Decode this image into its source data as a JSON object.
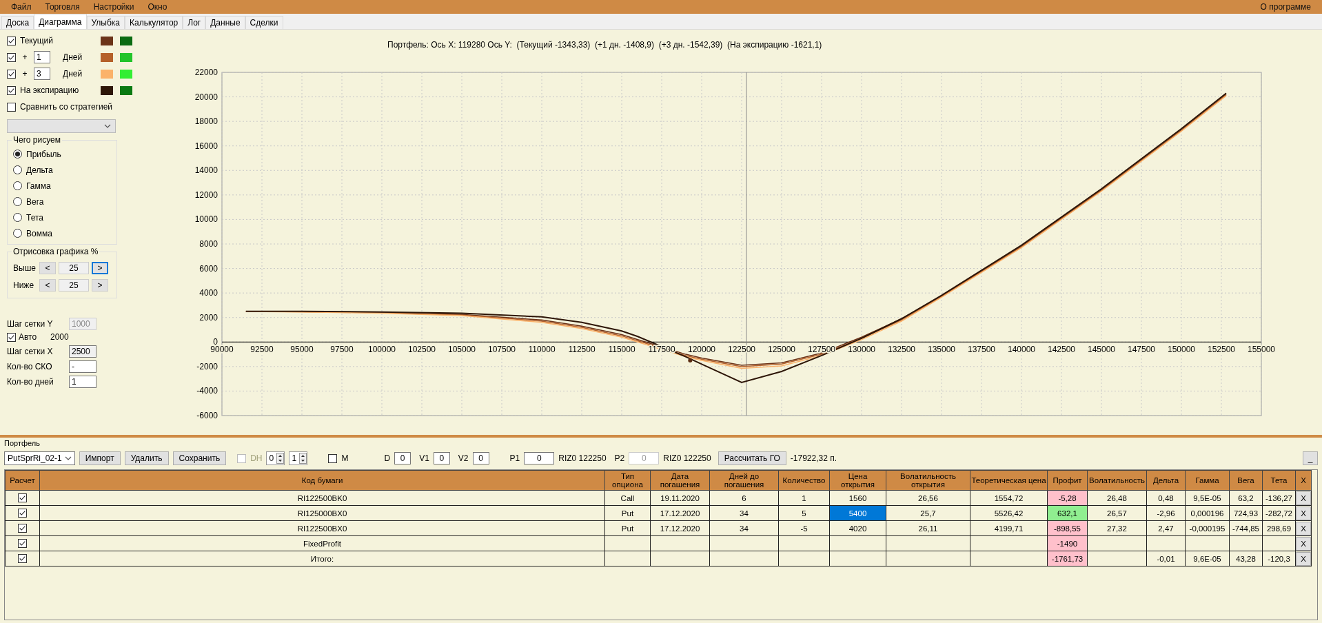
{
  "menu": {
    "items": [
      "Файл",
      "Торговля",
      "Настройки",
      "Окно"
    ],
    "about": "О программе"
  },
  "tabs": [
    {
      "label": "Доска",
      "selected": false
    },
    {
      "label": "Диаграмма",
      "selected": true
    },
    {
      "label": "Улыбка",
      "selected": false
    },
    {
      "label": "Калькулятор",
      "selected": false
    },
    {
      "label": "Лог",
      "selected": false
    },
    {
      "label": "Данные",
      "selected": false
    },
    {
      "label": "Сделки",
      "selected": false
    }
  ],
  "diagram": {
    "series_toggles": [
      {
        "kind": "label",
        "checked": true,
        "label": "Текущий",
        "swatches": [
          {
            "color": "#6b3318"
          },
          {
            "color": "#0b6b12"
          }
        ]
      },
      {
        "kind": "days",
        "checked": true,
        "sign": "+",
        "days": "1",
        "unit": "Дней",
        "swatches": [
          {
            "color": "#b5602a"
          },
          {
            "color": "#22c42a"
          }
        ]
      },
      {
        "kind": "days",
        "checked": true,
        "sign": "+",
        "days": "3",
        "unit": "Дней",
        "swatches": [
          {
            "color": "#fbb26a"
          },
          {
            "color": "#33ee33"
          }
        ]
      },
      {
        "kind": "label",
        "checked": true,
        "label": "На экспирацию",
        "swatches": [
          {
            "color": "#2e1608"
          },
          {
            "color": "#0a7a12"
          }
        ]
      }
    ],
    "compare": {
      "label": "Сравнить со стратегией",
      "checked": false
    },
    "strategy_dropdown": {
      "disabled": true
    },
    "draw_group": {
      "title": "Чего рисуем",
      "options": [
        {
          "label": "Прибыль",
          "selected": true
        },
        {
          "label": "Дельта",
          "selected": false
        },
        {
          "label": "Гамма",
          "selected": false
        },
        {
          "label": "Вега",
          "selected": false
        },
        {
          "label": "Тета",
          "selected": false
        },
        {
          "label": "Вомма",
          "selected": false
        }
      ]
    },
    "range_group": {
      "title": "Отрисовка графика %",
      "rows": [
        {
          "label": "Выше",
          "value": "25",
          "buttons": [
            {
              "text": "<",
              "focused": false
            },
            {
              "text": ">",
              "focused": true
            }
          ]
        },
        {
          "label": "Ниже",
          "value": "25",
          "buttons": [
            {
              "text": "<",
              "focused": false
            },
            {
              "text": ">",
              "focused": false
            }
          ]
        }
      ]
    },
    "fields": [
      {
        "label": "Шаг сетки Y",
        "value": "1000",
        "disabled": true,
        "readonly": false
      },
      {
        "label": "Шаг сетки X",
        "value": "2500",
        "disabled": false,
        "readonly": true
      },
      {
        "label": "Кол-во СКО",
        "value": "-",
        "disabled": false,
        "readonly": false
      },
      {
        "label": "Кол-во дней",
        "value": "1",
        "disabled": false,
        "readonly": false
      }
    ],
    "auto": {
      "label": "Авто",
      "checked": true,
      "value": "2000"
    },
    "chart_title": "Портфель: Ось X: 119280 Ось Y:  (Текущий -1343,33)  (+1 дн. -1408,9)  (+3 дн. -1542,39)  (На экспирацию -1621,1)",
    "chart_data": {
      "type": "line",
      "x": [
        91500,
        95000,
        100000,
        105000,
        110000,
        112500,
        115000,
        116000,
        119000,
        120000,
        122500,
        125000,
        127500,
        130000,
        132500,
        135000,
        140000,
        145000,
        150000,
        152800
      ],
      "series": [
        {
          "color": "#6b3318",
          "values": [
            2500,
            2480,
            2400,
            2250,
            1800,
            1300,
            600,
            200,
            -1000,
            -1300,
            -1900,
            -1700,
            -900,
            400,
            1900,
            3750,
            7800,
            12400,
            17300,
            20200
          ]
        },
        {
          "color": "#b5602a",
          "values": [
            2500,
            2470,
            2380,
            2200,
            1700,
            1200,
            500,
            100,
            -1100,
            -1400,
            -2000,
            -1800,
            -1000,
            300,
            1800,
            3700,
            7750,
            12350,
            17250,
            20150
          ]
        },
        {
          "color": "#fbb26a",
          "values": [
            2490,
            2450,
            2350,
            2150,
            1600,
            1100,
            400,
            0,
            -1200,
            -1500,
            -2150,
            -1950,
            -1100,
            200,
            1700,
            3650,
            7700,
            12300,
            17200,
            20100
          ]
        },
        {
          "color": "#2e1608",
          "values": [
            2500,
            2500,
            2450,
            2350,
            2050,
            1600,
            900,
            450,
            -1200,
            -1800,
            -3300,
            -2400,
            -1100,
            300,
            1900,
            3800,
            7900,
            12500,
            17400,
            20300
          ]
        }
      ],
      "xlim": [
        90000,
        155000
      ],
      "ylim": [
        -6000,
        22000
      ],
      "grid": true,
      "ref_lines": [
        {
          "axis": "x",
          "value": 122800
        }
      ],
      "xticks": [
        90000,
        92500,
        95000,
        97500,
        100000,
        102500,
        105000,
        107500,
        110000,
        112500,
        115000,
        117500,
        120000,
        122500,
        125000,
        127500,
        130000,
        132500,
        135000,
        137500,
        140000,
        142500,
        145000,
        147500,
        150000,
        152500,
        155000
      ],
      "yticks": [
        -6000,
        -4000,
        -2000,
        0,
        2000,
        4000,
        6000,
        8000,
        10000,
        12000,
        14000,
        16000,
        18000,
        20000,
        22000
      ]
    }
  },
  "portfolio": {
    "title": "Портфель",
    "strategy": "PutSprRi_02-1",
    "buttons": [
      "Импорт",
      "Удалить",
      "Сохранить"
    ],
    "dh": {
      "label": "DH",
      "checked": false,
      "disabled": true
    },
    "spinners": [
      "0",
      "1"
    ],
    "m": {
      "label": "M",
      "checked": false
    },
    "params": [
      {
        "label": "D",
        "value": "0",
        "disabled": false
      },
      {
        "label": "V1",
        "value": "0",
        "disabled": false
      },
      {
        "label": "V2",
        "value": "0",
        "disabled": false
      },
      {
        "label": "P1",
        "value": "0",
        "disabled": false,
        "ticker": "RIZ0 122250"
      },
      {
        "label": "P2",
        "value": "0",
        "disabled": true,
        "ticker": "RIZ0 122250"
      }
    ],
    "calc_button": "Рассчитать ГО",
    "margin": "-17922,32 п.",
    "minimize_button": "_",
    "table": {
      "columns": [
        "Расчет",
        "Код бумаги",
        "Тип опциона",
        "Дата погашения",
        "Дней до погашения",
        "Количество",
        "Цена открытия",
        "Волатильность открытия",
        "Теоретическая цена",
        "Профит",
        "Волатильность",
        "Дельта",
        "Гамма",
        "Вега",
        "Тета",
        "X"
      ],
      "rows": [
        {
          "checked": true,
          "code": "RI122500BK0",
          "type": "Call",
          "date": "19.11.2020",
          "days": "6",
          "qty": "1",
          "open_price": "1560",
          "open_price_selected": false,
          "open_vol": "26,56",
          "theo": "1554,72",
          "profit": {
            "text": "-5,28",
            "color": "#ffc0cb"
          },
          "vol": "26,48",
          "delta": "0,48",
          "gamma": "9,5E-05",
          "vega": "63,2",
          "theta": "-136,27",
          "delete": "X"
        },
        {
          "checked": true,
          "code": "RI125000BX0",
          "type": "Put",
          "date": "17.12.2020",
          "days": "34",
          "qty": "5",
          "open_price": "5400",
          "open_price_selected": true,
          "open_vol": "25,7",
          "theo": "5526,42",
          "profit": {
            "text": "632,1",
            "color": "#90ee90"
          },
          "vol": "26,57",
          "delta": "-2,96",
          "gamma": "0,000196",
          "vega": "724,93",
          "theta": "-282,72",
          "delete": "X"
        },
        {
          "checked": true,
          "code": "RI122500BX0",
          "type": "Put",
          "date": "17.12.2020",
          "days": "34",
          "qty": "-5",
          "open_price": "4020",
          "open_price_selected": false,
          "open_vol": "26,11",
          "theo": "4199,71",
          "profit": {
            "text": "-898,55",
            "color": "#ffc0cb"
          },
          "vol": "27,32",
          "delta": "2,47",
          "gamma": "-0,000195",
          "vega": "-744,85",
          "theta": "298,69",
          "delete": "X"
        },
        {
          "checked": true,
          "code": "FixedProfit",
          "profit": {
            "text": "-1490",
            "color": "#ffc0cb"
          },
          "open_price_selected": false,
          "delete": "X"
        },
        {
          "checked": true,
          "code": "Итого:",
          "profit": {
            "text": "-1761,73",
            "color": "#ffc0cb"
          },
          "open_price_selected": false,
          "delta": "-0,01",
          "gamma": "9,6E-05",
          "vega": "43,28",
          "theta": "-120,3",
          "delete": "X"
        }
      ]
    }
  }
}
